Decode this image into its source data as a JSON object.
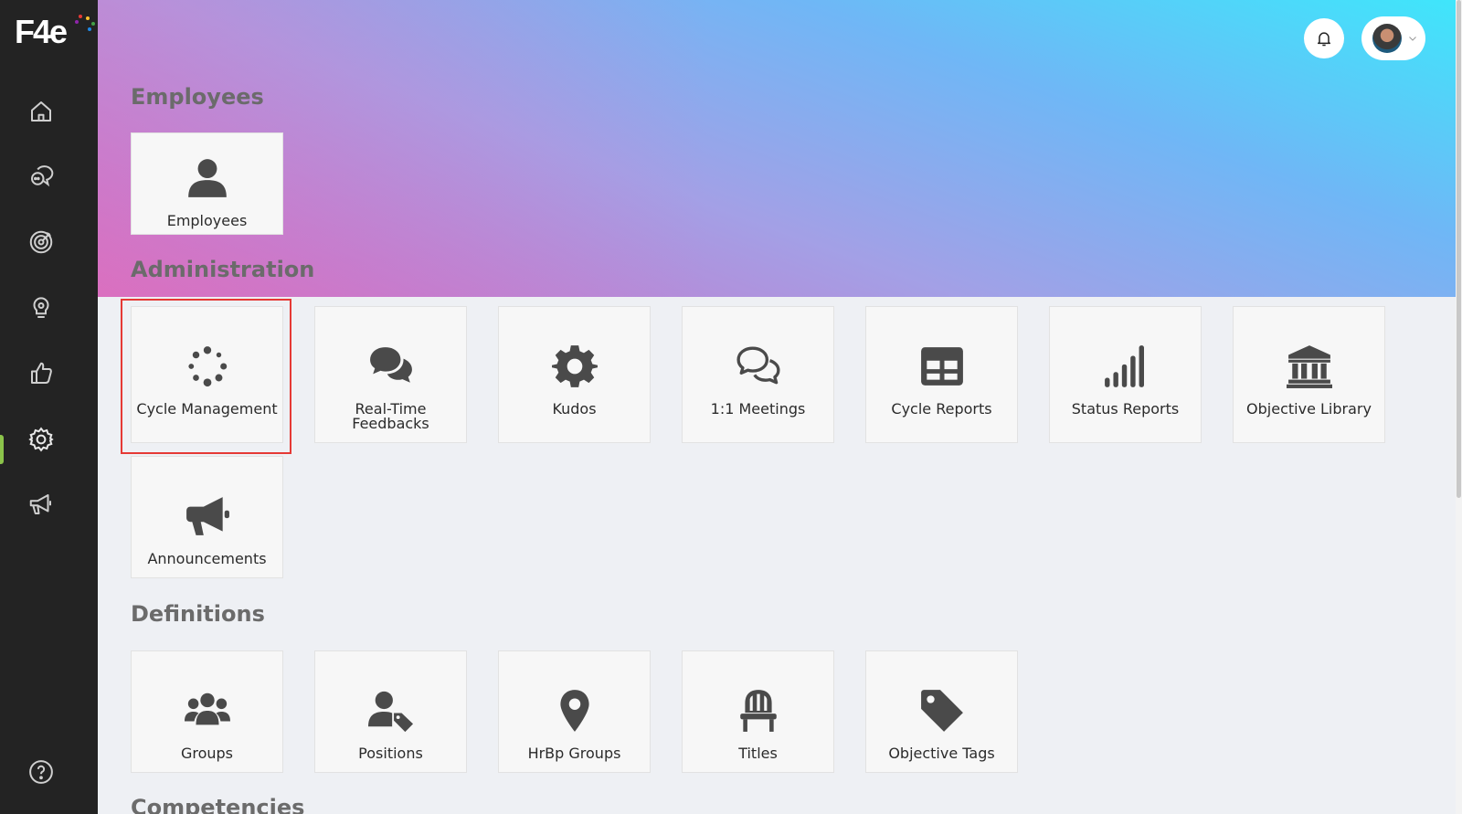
{
  "app": {
    "logo_text": "F4e",
    "logo_dot_colors": [
      "#e53935",
      "#fbc02d",
      "#43a047",
      "#1e88e5",
      "#8e24aa"
    ]
  },
  "colors": {
    "sidebar_bg": "#232323",
    "active_accent": "#8bc34a",
    "highlight": "#e53935",
    "icon": "#4a4a4a"
  },
  "sidebar": {
    "items": [
      {
        "name": "home-icon"
      },
      {
        "name": "chat-bubbles-icon"
      },
      {
        "name": "target-icon"
      },
      {
        "name": "lightbulb-icon"
      },
      {
        "name": "thumbs-up-icon"
      },
      {
        "name": "gear-icon",
        "active": true
      },
      {
        "name": "megaphone-icon"
      },
      {
        "name": "help-icon"
      }
    ]
  },
  "header": {
    "notifications_icon": "bell-icon",
    "profile_icon": "chevron-down-icon"
  },
  "sections": {
    "employees": {
      "title": "Employees",
      "tiles": [
        {
          "label": "Employees",
          "icon": "user-icon"
        }
      ]
    },
    "administration": {
      "title": "Administration",
      "tiles": [
        {
          "label": "Cycle Management",
          "icon": "spinner-icon",
          "highlighted": true
        },
        {
          "label": "Real-Time Feedbacks",
          "icon": "comments-icon"
        },
        {
          "label": "Kudos",
          "icon": "cog-icon"
        },
        {
          "label": "1:1 Meetings",
          "icon": "comments-outline-icon"
        },
        {
          "label": "Cycle Reports",
          "icon": "table-icon"
        },
        {
          "label": "Status Reports",
          "icon": "signal-bars-icon"
        },
        {
          "label": "Objective Library",
          "icon": "bank-icon"
        },
        {
          "label": "Announcements",
          "icon": "bullhorn-icon"
        }
      ]
    },
    "definitions": {
      "title": "Definitions",
      "tiles": [
        {
          "label": "Groups",
          "icon": "users-icon"
        },
        {
          "label": "Positions",
          "icon": "user-tag-icon"
        },
        {
          "label": "HrBp Groups",
          "icon": "map-marker-icon"
        },
        {
          "label": "Titles",
          "icon": "chair-icon"
        },
        {
          "label": "Objective Tags",
          "icon": "tag-icon"
        }
      ]
    },
    "competencies": {
      "title": "Competencies"
    }
  }
}
